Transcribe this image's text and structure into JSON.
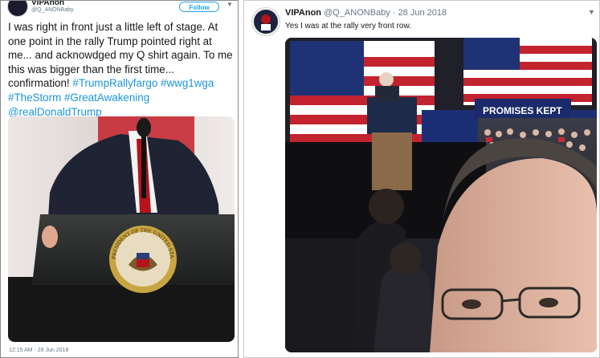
{
  "left_tweet": {
    "display_name": "VIPAnon",
    "handle": "@Q_ANONBaby",
    "follow_label": "Follow",
    "caret_icon": "chevron-down-icon",
    "text_plain_1": "I was right in front just a little left of stage.  At one point in the rally Trump pointed right at me... and acknowdged my Q shirt again.  To me this was bigger than the first time... confirmation! ",
    "hashtags": [
      "#TrumpRallyfargo",
      "#wwg1wga",
      "#TheStorm",
      "#GreatAwakening"
    ],
    "mention": "@realDonaldTrump",
    "seal_text": "PRESIDENT OF THE UNITED STATES",
    "timestamp": "12:15 AM - 28 Jun 2018"
  },
  "right_tweet": {
    "display_name": "VIPAnon",
    "handle": "@Q_ANONBaby",
    "separator": " · ",
    "date": "28 Jun 2018",
    "caret_icon": "chevron-down-icon",
    "text": "Yes I was at the rally very front row.",
    "banner_text": "PROMISES KEPT"
  },
  "colors": {
    "link": "#1b95e0",
    "follow_blue": "#1da1f2",
    "text": "#14171a",
    "muted": "#657786"
  }
}
